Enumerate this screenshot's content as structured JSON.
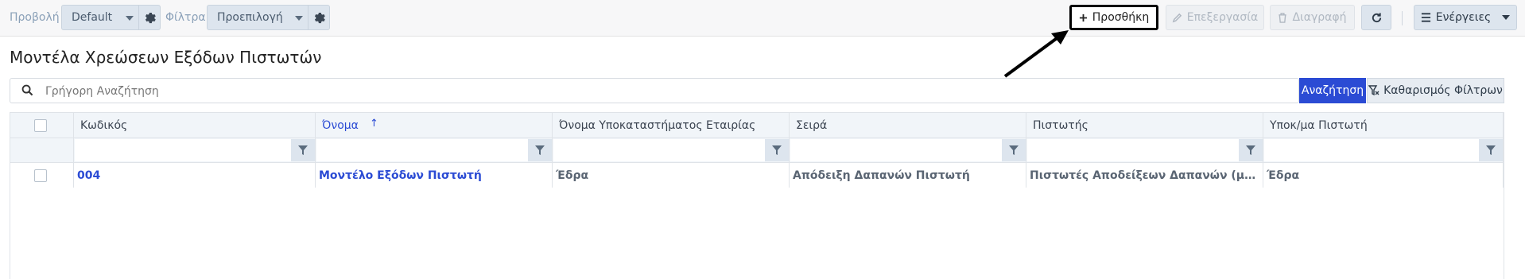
{
  "toolbar": {
    "view_label": "Προβολή",
    "view_value": "Default",
    "filters_label": "Φίλτρα",
    "filters_value": "Προεπιλογή",
    "add_label": "Προσθήκη",
    "edit_label": "Επεξεργασία",
    "delete_label": "Διαγραφή",
    "actions_label": "Ενέργειες"
  },
  "page": {
    "title": "Μοντέλα Χρεώσεων Εξόδων Πιστωτών"
  },
  "search": {
    "placeholder": "Γρήγορη Αναζήτηση",
    "search_button": "Αναζήτηση",
    "clear_button": "Καθαρισμός Φίλτρων"
  },
  "grid": {
    "columns": [
      {
        "label": "Κωδικός",
        "sorted": false
      },
      {
        "label": "Όνομα",
        "sorted": true,
        "sort_dir": "asc"
      },
      {
        "label": "Όνομα Υποκαταστήματος Εταιρίας",
        "sorted": false
      },
      {
        "label": "Σειρά",
        "sorted": false
      },
      {
        "label": "Πιστωτής",
        "sorted": false
      },
      {
        "label": "Υποκ/μα Πιστωτή",
        "sorted": false
      }
    ],
    "rows": [
      [
        "004",
        "Μοντέλο Εξόδων Πιστωτή",
        "Έδρα",
        "Απόδειξη Δαπανών Πιστωτή",
        "Πιστωτές Αποδείξεων Δαπανών (μικροέξοδα)",
        "Έδρα"
      ]
    ]
  },
  "colors": {
    "accent": "#2b4bd4",
    "toolbar_bg": "#f7f7f8",
    "select_bg": "#dde5ee",
    "header_bg": "#f1f5f9"
  },
  "icons": [
    "gear-icon",
    "plus-icon",
    "pencil-icon",
    "trash-icon",
    "refresh-icon",
    "menu-icon",
    "search-icon",
    "filter-icon",
    "filter-clear-icon",
    "sort-up-icon",
    "annotation-arrow"
  ]
}
